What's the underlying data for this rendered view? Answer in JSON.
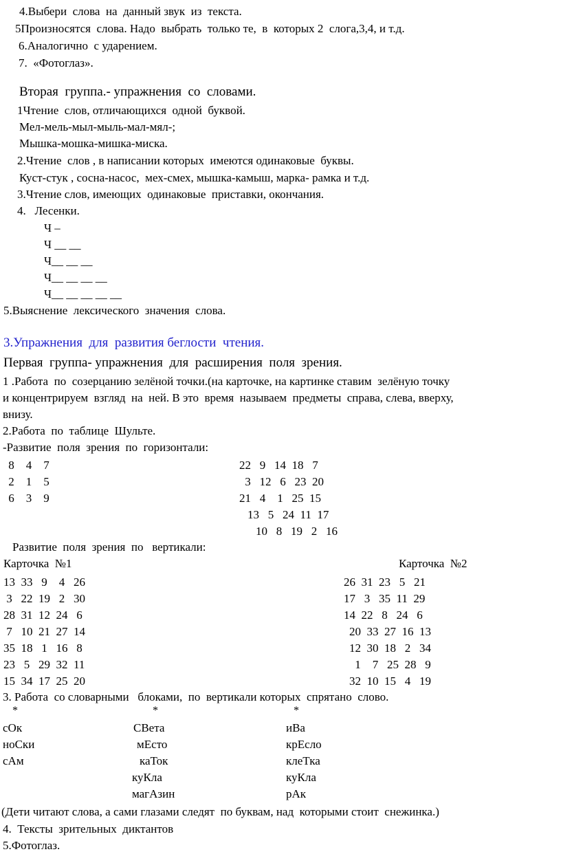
{
  "document": {
    "title": "Упражнения для развития беглости чтения",
    "accent_color": "#2222cc",
    "text_color": "#000000",
    "background_color": "#ffffff"
  },
  "section_first_group_tail": {
    "items": [
      "4.Выбери  слова  на  данный звук  из  текста.",
      "5Произносятся  слова. Надо  выбрать  только те,  в  которых 2  слога,3,4, и т.д.",
      "6.Аналогично  с ударением.",
      "7.  «Фотоглаз»."
    ]
  },
  "section_second_group": {
    "heading": "Вторая  группа.- упражнения  со  словами.",
    "items": [
      "1Чтение  слов, отличающихся  одной  буквой.",
      "Мел-мель-мыл-мыль-мал-мял-;",
      "Мышка-мошка-мишка-миска.",
      "2.Чтение  слов , в написании которых  имеются одинаковые  буквы.",
      "Куст-стук , сосна-насос,  мех-смех, мышка-камыш, марка- рамка и т.д.",
      "3.Чтение слов, имеющих  одинаковые  приставки, окончания.",
      "4.   Лесенки."
    ],
    "ladder": {
      "letter": "Ч",
      "rows": [
        "Ч –",
        "Ч __ __",
        "Ч__ __ __",
        "Ч__ __ __ __",
        "Ч__ __ __ __ __"
      ]
    },
    "closing": "5.Выяснение  лексического  значения  слова."
  },
  "section_fluency": {
    "heading": "3.Упражнения  для  развития беглости  чтения.",
    "subheading": "Первая  группа- упражнения  для  расширения  поля  зрения.",
    "paragraph_lines": [
      "1 .Работа  по  созерцанию зелёной точки.(на карточке, на картинке ставим  зелёную точку",
      "и концентрируем  взгляд  на  ней. В это  время  называем  предметы  справа, слева, вверху,",
      "внизу."
    ],
    "schulte_intro": "2.Работа  по  таблице  Шульте.",
    "horizontal_label": "-Развитие  поля  зрения  по  горизонтали:",
    "table_3x3": [
      [
        8,
        4,
        7
      ],
      [
        2,
        1,
        5
      ],
      [
        6,
        3,
        9
      ]
    ],
    "table_5x5": [
      [
        22,
        9,
        14,
        18,
        7
      ],
      [
        3,
        12,
        6,
        23,
        20
      ],
      [
        21,
        4,
        1,
        25,
        15
      ],
      [
        13,
        5,
        24,
        11,
        17
      ],
      [
        10,
        8,
        19,
        2,
        16
      ]
    ],
    "vertical_label": "Развитие  поля  зрения  по   вертикали:",
    "card1_title": "Карточка  №1",
    "card2_title": "Карточка  №2",
    "card1_rows": [
      [
        13,
        33,
        9,
        4,
        26
      ],
      [
        3,
        22,
        19,
        2,
        30
      ],
      [
        28,
        31,
        12,
        24,
        6
      ],
      [
        7,
        10,
        21,
        27,
        14
      ],
      [
        35,
        18,
        1,
        16,
        8
      ],
      [
        23,
        5,
        29,
        32,
        11
      ],
      [
        15,
        34,
        17,
        25,
        20
      ]
    ],
    "card2_rows": [
      [
        26,
        31,
        23,
        5,
        21
      ],
      [
        17,
        3,
        35,
        11,
        29
      ],
      [
        14,
        22,
        8,
        24,
        6
      ],
      [
        20,
        33,
        27,
        16,
        13
      ],
      [
        12,
        30,
        18,
        2,
        34
      ],
      [
        1,
        7,
        25,
        28,
        9
      ],
      [
        32,
        10,
        15,
        4,
        19
      ]
    ]
  },
  "section_word_blocks": {
    "heading": "3. Работа  со словарными   блоками,  по  вертикали которых  спрятано  слово.",
    "star": "*",
    "column1": [
      "сОк",
      "ноСки",
      "сАм"
    ],
    "column2": [
      "СВета",
      "мЕсто",
      "каТок",
      "куКла",
      "магАзин"
    ],
    "column3": [
      "иВа",
      "крЕсло",
      "клеТка",
      "куКла",
      "рАк"
    ],
    "note": "(Дети читают слова, а сами глазами следят  по буквам, над  которыми стоит  снежинка.)",
    "footer_lines": [
      "4.  Тексты  зрительных  диктантов",
      "5.Фотоглаз."
    ]
  }
}
